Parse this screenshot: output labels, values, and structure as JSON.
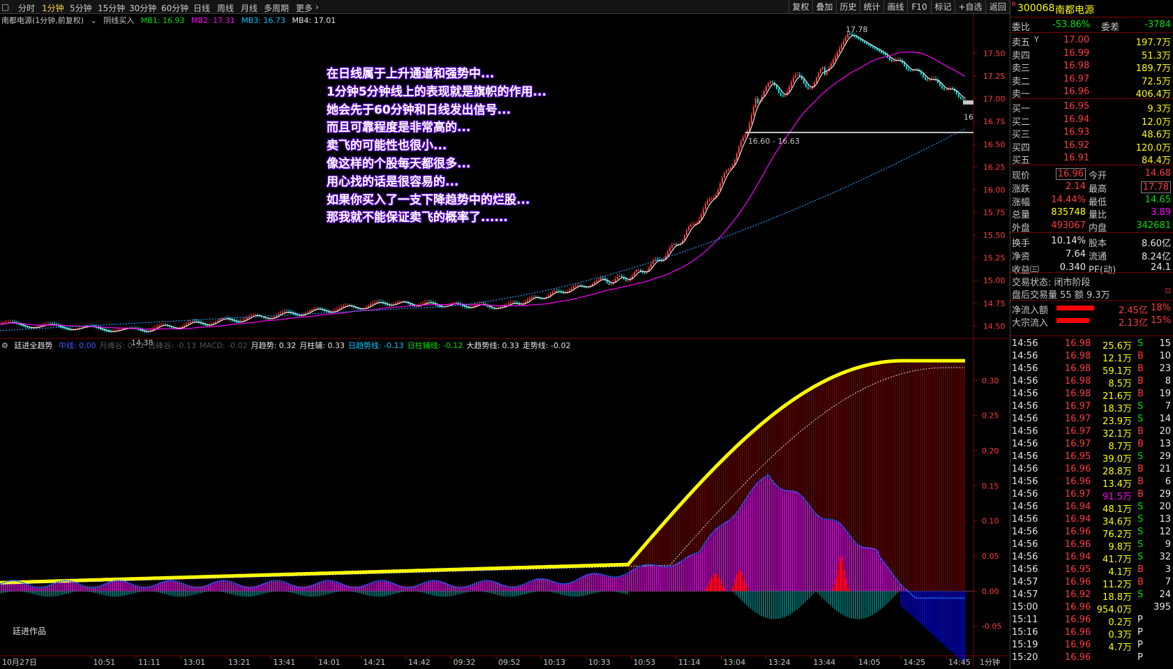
{
  "period_tabs": [
    "分时",
    "1分钟",
    "5分钟",
    "15分钟",
    "30分钟",
    "60分钟",
    "日线",
    "周线",
    "月线",
    "多周期",
    "更多"
  ],
  "active_period": "1分钟",
  "toolbar": [
    "复权",
    "叠加",
    "历史",
    "统计",
    "画线",
    "F10",
    "标记",
    "+自选",
    "返回"
  ],
  "chart_label": {
    "title": "南都电源(1分钟,前复权)",
    "tag": "阴线买入",
    "mb1": "MB1: 16.93",
    "mb2": "MB2: 17.31",
    "mb3": "MB3: 16.73",
    "mb4": "MB4: 17.01"
  },
  "annotation_lines": [
    "在日线属于上升通道和强势中...",
    "1分钟5分钟线上的表现就是旗帜的作用...",
    "她会先于60分钟和日线发出信号...",
    "而且可靠程度是非常高的...",
    "卖飞的可能性也很小...",
    "像这样的个股每天都很多...",
    "用心找的话是很容易的...",
    "如果你买入了一支下降趋势中的烂股...",
    "那我就不能保证卖飞的概率了......"
  ],
  "price_axis": {
    "ticks": [
      "17.50",
      "17.25",
      "17.00",
      "16.75",
      "16.50",
      "16.25",
      "16.00",
      "15.75",
      "15.50",
      "15.25",
      "15.00",
      "14.75",
      "14.50"
    ],
    "min": 14.38,
    "max": 17.78
  },
  "price_marks": {
    "high": "17.78",
    "low": "14.38",
    "range": "16.60 - 16.63",
    "edge": "16"
  },
  "indicator_label": {
    "name": "廷进全趋势",
    "items": [
      "中线: 0.00",
      "月峰谷: 0.32",
      "日峰谷: -0.13",
      "MACD: -0.02",
      "月趋势: 0.32",
      "月柱辅: 0.33",
      "日趋势线: -0.13",
      "日柱辅线: -0.12",
      "大趋势线: 0.33",
      "走势线: -0.02"
    ],
    "colors": [
      "#3a5cff",
      "#555555",
      "#555555",
      "#555555",
      "#e8e8e8",
      "#e8e8e8",
      "#00c8ff",
      "#00e000",
      "#e8e8e8",
      "#e8e8e8"
    ]
  },
  "indicator_axis": {
    "ticks": [
      "0.30",
      "0.25",
      "0.20",
      "0.15",
      "0.10",
      "0.05",
      "0.00",
      "-0.05"
    ]
  },
  "time_axis": {
    "labels": [
      "10月27日",
      "10:51",
      "11:11",
      "13:01",
      "13:21",
      "13:41",
      "14:01",
      "14:21",
      "14:42",
      "09:32",
      "09:52",
      "10:13",
      "10:33",
      "10:53",
      "11:14",
      "13:04",
      "13:24",
      "13:44",
      "14:05",
      "14:25",
      "14:45"
    ],
    "period": "1分钟"
  },
  "credit": "廷进作品",
  "quote": {
    "code": "300068",
    "name": "南都电源",
    "badge": "R",
    "weibi_label": "委比",
    "weibi": "-53.86%",
    "weicha_label": "委差",
    "weicha": "-3784",
    "sell": [
      {
        "label": "卖五",
        "price": "17.00",
        "vol": "197.7万",
        "mark": "Y"
      },
      {
        "label": "卖四",
        "price": "16.99",
        "vol": "51.3万"
      },
      {
        "label": "卖三",
        "price": "16.98",
        "vol": "189.7万"
      },
      {
        "label": "卖二",
        "price": "16.97",
        "vol": "72.5万"
      },
      {
        "label": "卖一",
        "price": "16.96",
        "vol": "406.4万"
      }
    ],
    "buy": [
      {
        "label": "买一",
        "price": "16.95",
        "vol": "9.3万"
      },
      {
        "label": "买二",
        "price": "16.94",
        "vol": "12.0万"
      },
      {
        "label": "买三",
        "price": "16.93",
        "vol": "48.6万"
      },
      {
        "label": "买四",
        "price": "16.92",
        "vol": "120.0万"
      },
      {
        "label": "买五",
        "price": "16.91",
        "vol": "84.4万"
      }
    ],
    "stats": [
      [
        "现价",
        "16.96",
        "今开",
        "14.68"
      ],
      [
        "涨跌",
        "2.14",
        "最高",
        "17.78"
      ],
      [
        "涨幅",
        "14.44%",
        "最低",
        "14.65"
      ],
      [
        "总量",
        "835748",
        "量比",
        "3.89"
      ],
      [
        "外盘",
        "493067",
        "内盘",
        "342681"
      ]
    ],
    "stats2": [
      [
        "换手",
        "10.14%",
        "股本",
        "8.60亿"
      ],
      [
        "净资",
        "7.64",
        "流通",
        "8.24亿"
      ],
      [
        "收益㈢",
        "0.340",
        "PE(动)",
        "24.1"
      ]
    ],
    "trade_status": "交易状态: 闭市阶段",
    "after_hours": "盘后交易量 55 额 9.3万",
    "net_inflow_label": "净流入额",
    "net_inflow": "2.45亿",
    "net_inflow_pct": "18%",
    "block_inflow_label": "大宗流入",
    "block_inflow": "2.13亿",
    "block_inflow_pct": "15%"
  },
  "trades": [
    [
      "14:56",
      "16.98",
      "25.6万",
      "S",
      "15"
    ],
    [
      "14:56",
      "16.98",
      "12.1万",
      "B",
      "10"
    ],
    [
      "14:56",
      "16.98",
      "59.1万",
      "B",
      "23"
    ],
    [
      "14:56",
      "16.98",
      "8.5万",
      "B",
      "8"
    ],
    [
      "14:56",
      "16.98",
      "21.6万",
      "B",
      "19"
    ],
    [
      "14:56",
      "16.97",
      "18.3万",
      "S",
      "7"
    ],
    [
      "14:56",
      "16.97",
      "23.9万",
      "S",
      "14"
    ],
    [
      "14:56",
      "16.97",
      "32.1万",
      "B",
      "20"
    ],
    [
      "14:56",
      "16.97",
      "8.7万",
      "B",
      "13"
    ],
    [
      "14:56",
      "16.95",
      "39.0万",
      "S",
      "29"
    ],
    [
      "14:56",
      "16.96",
      "28.8万",
      "B",
      "21"
    ],
    [
      "14:56",
      "16.96",
      "13.4万",
      "B",
      "6"
    ],
    [
      "14:56",
      "16.97",
      "91.5万",
      "B",
      "29"
    ],
    [
      "14:56",
      "16.94",
      "48.1万",
      "S",
      "20"
    ],
    [
      "14:56",
      "16.94",
      "34.6万",
      "S",
      "13"
    ],
    [
      "14:56",
      "16.96",
      "76.2万",
      "S",
      "12"
    ],
    [
      "14:56",
      "16.96",
      "9.8万",
      "S",
      "9"
    ],
    [
      "14:56",
      "16.94",
      "41.7万",
      "S",
      "32"
    ],
    [
      "14:56",
      "16.95",
      "4.1万",
      "B",
      "3"
    ],
    [
      "14:57",
      "16.96",
      "11.2万",
      "B",
      "7"
    ],
    [
      "14:57",
      "16.92",
      "18.8万",
      "S",
      "24"
    ],
    [
      "15:00",
      "16.96",
      "954.0万",
      "",
      "395"
    ],
    [
      "15:11",
      "16.96",
      "0.2万",
      "P",
      ""
    ],
    [
      "15:16",
      "16.96",
      "0.3万",
      "P",
      ""
    ],
    [
      "15:19",
      "16.96",
      "4.7万",
      "P",
      ""
    ],
    [
      "15:20",
      "16.96",
      "",
      "P",
      ""
    ]
  ],
  "colors": {
    "up": "#ff3c3c",
    "down": "#00e0e0",
    "yellow": "#ffff00",
    "magenta": "#ff00ff",
    "red": "#ff3c3c",
    "green": "#00e000",
    "blue": "#0000ff",
    "teal": "#008c8c",
    "grid": "#7a0000"
  }
}
